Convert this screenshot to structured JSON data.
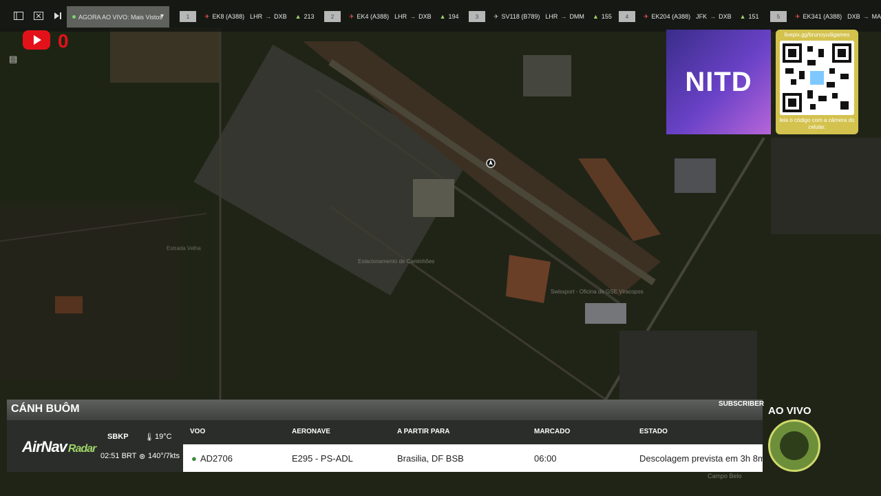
{
  "toolbar": {
    "live_label": "AGORA AO VIVO: Mais Vistos"
  },
  "flights_ticker": [
    {
      "index": "1",
      "callsign": "EK8 (A388)",
      "from": "LHR",
      "to": "DXB",
      "count": "213"
    },
    {
      "index": "2",
      "callsign": "EK4 (A388)",
      "from": "LHR",
      "to": "DXB",
      "count": "194"
    },
    {
      "index": "3",
      "callsign": "SV118 (B789)",
      "from": "LHR",
      "to": "DMM",
      "count": "155"
    },
    {
      "index": "4",
      "callsign": "EK204 (A388)",
      "from": "JFK",
      "to": "DXB",
      "count": "151"
    },
    {
      "index": "5",
      "callsign": "EK341 (A388)",
      "from": "DXB",
      "to": "MAD",
      "count": ""
    }
  ],
  "youtube": {
    "count": "0"
  },
  "sponsor": {
    "logo_text": "NITD",
    "qr_url": "livepix.gg/brunoyudigames",
    "qr_caption": "leia o código com a câmera do celular."
  },
  "map_labels": [
    "Estacionamento de Caminhões",
    "Swissport - Oficina da GSE Viracopos",
    "Campo Belo",
    "Estrada Velha"
  ],
  "panel": {
    "title": "CÁNH BUÔM",
    "subscriber": "SUBSCRIBER",
    "brand_main": "AirNav",
    "brand_sub": "Radar",
    "airport": "SBKP",
    "time": "02:51 BRT",
    "temperature": "19°C",
    "wind": "140°/7kts",
    "headers": [
      "VOO",
      "AERONAVE",
      "A PARTIR PARA",
      "MARCADO",
      "ESTADO"
    ],
    "row": [
      "AD2706",
      "E295 - PS-ADL",
      "Brasilia, DF BSB",
      "06:00",
      "Descolagem prevista em 3h 8m"
    ]
  },
  "live_badge": "AO VIVO"
}
